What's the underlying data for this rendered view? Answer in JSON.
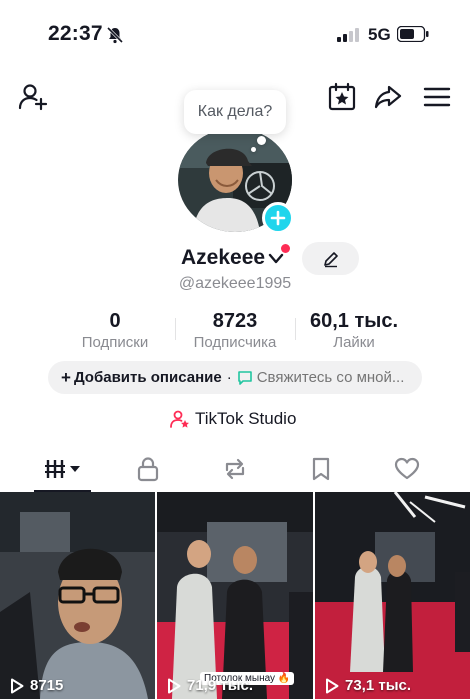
{
  "status_bar": {
    "time": "22:37",
    "network": "5G"
  },
  "bubble": {
    "text": "Как дела?"
  },
  "profile": {
    "name": "Azekeee",
    "handle": "@azekeee1995"
  },
  "stats": [
    {
      "value": "0",
      "label": "Подписки"
    },
    {
      "value": "8723",
      "label": "Подписчика"
    },
    {
      "value": "60,1 тыс.",
      "label": "Лайки"
    }
  ],
  "description": {
    "plus": "+",
    "add_label": "Добавить описание",
    "separator": "·",
    "message_label": "Свяжитесь со мной..."
  },
  "studio": {
    "label": "TikTok Studio"
  },
  "videos": [
    {
      "views": "8715"
    },
    {
      "views": "71,9 тыс.",
      "caption": "Потолок мынау 🔥"
    },
    {
      "views": "73,1 тыс."
    }
  ],
  "colors": {
    "accent_red": "#fe2c55",
    "accent_cyan": "#20d5ec",
    "text": "#161823",
    "muted": "#8a8b91"
  },
  "icons": {
    "top_left": "add-user-icon",
    "top_right": [
      "calendar-star-icon",
      "share-icon",
      "menu-icon"
    ],
    "tabs": [
      "grid-icon",
      "lock-icon",
      "repost-icon",
      "bookmark-icon",
      "heart-icon"
    ]
  }
}
